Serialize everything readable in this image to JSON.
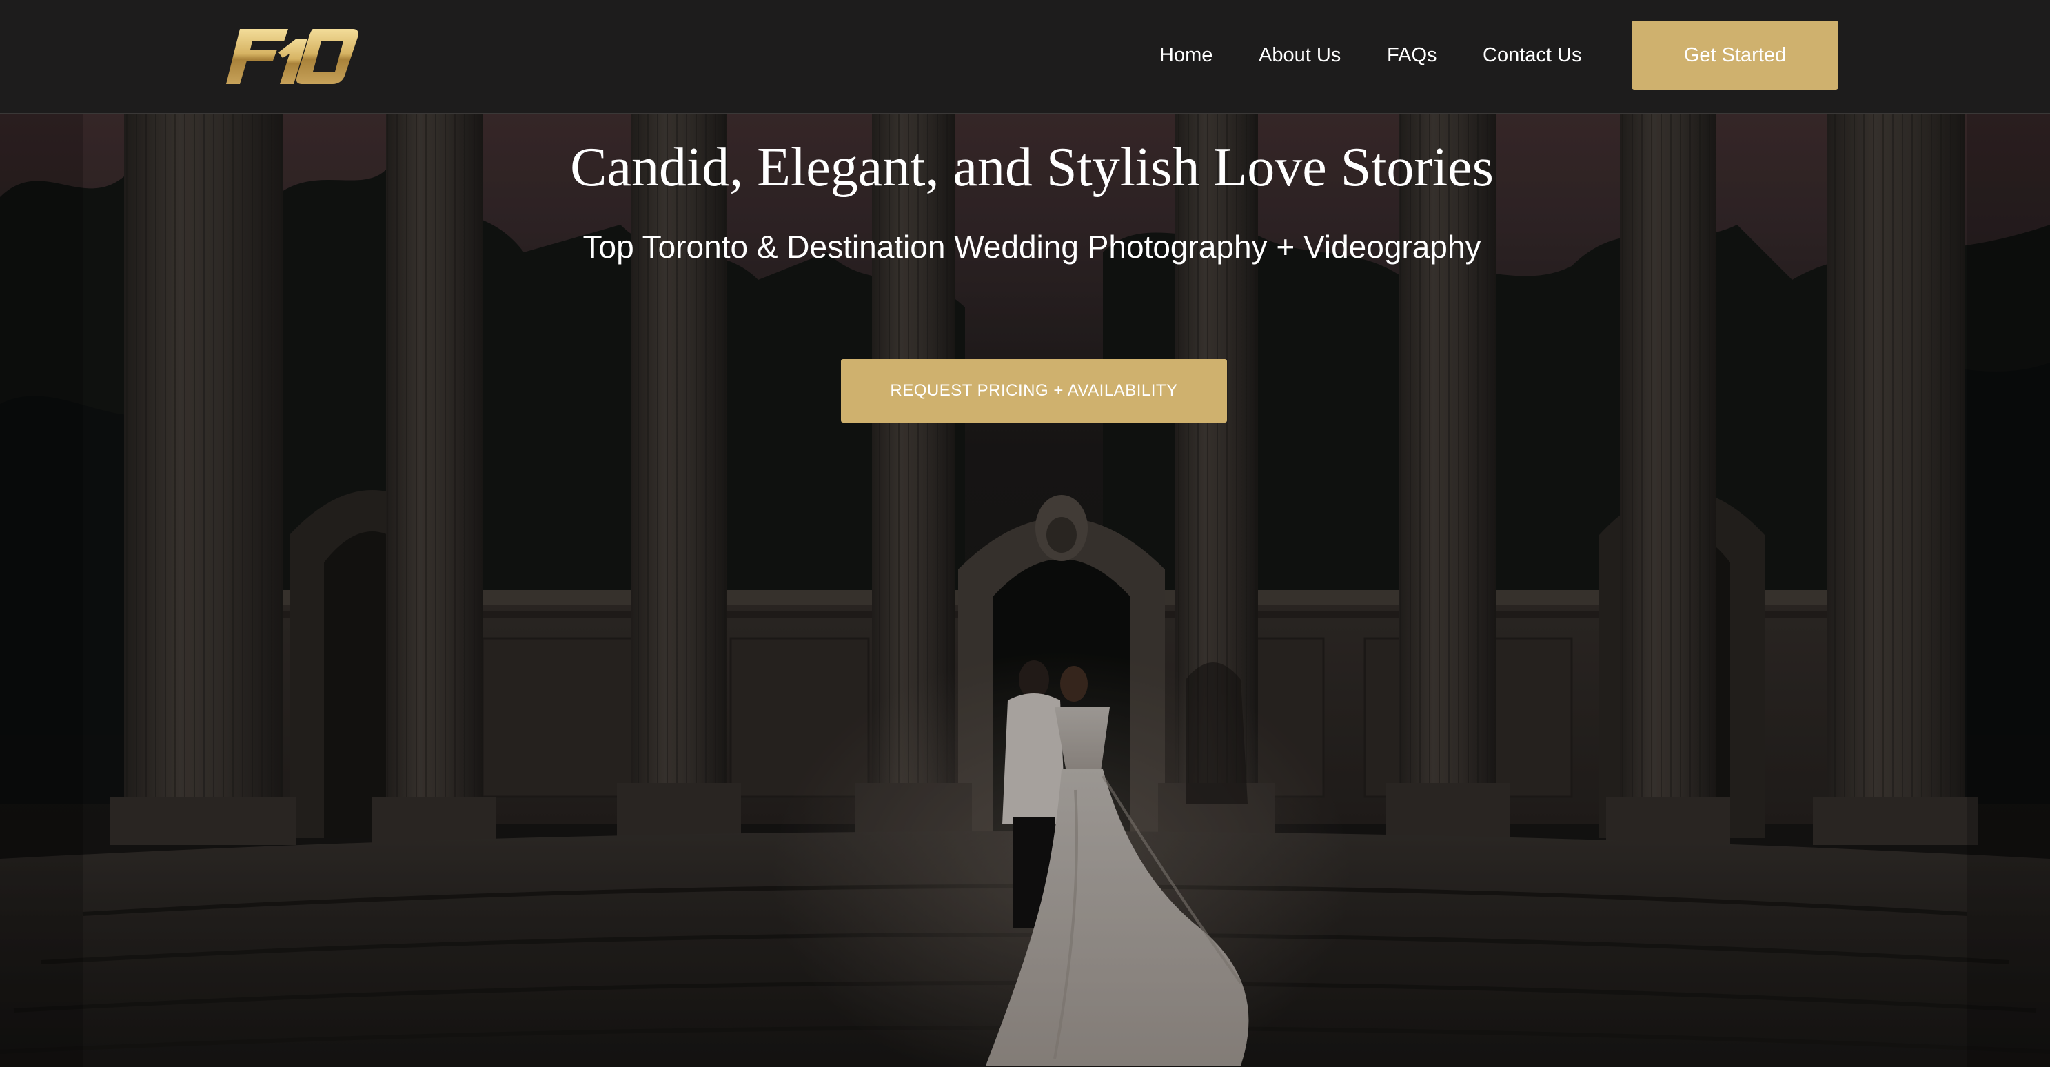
{
  "header": {
    "logo_text": "F10",
    "nav": {
      "home": "Home",
      "about": "About Us",
      "faqs": "FAQs",
      "contact": "Contact Us"
    },
    "cta_label": "Get Started"
  },
  "hero": {
    "title": "Candid, Elegant, and Stylish Love Stories",
    "subtitle": "Top Toronto & Destination Wedding Photography + Videography",
    "cta_label": "REQUEST PRICING + AVAILABILITY"
  },
  "colors": {
    "accent": "#cfb16e",
    "header_bg": "#1d1c1c",
    "text": "#ffffff"
  }
}
